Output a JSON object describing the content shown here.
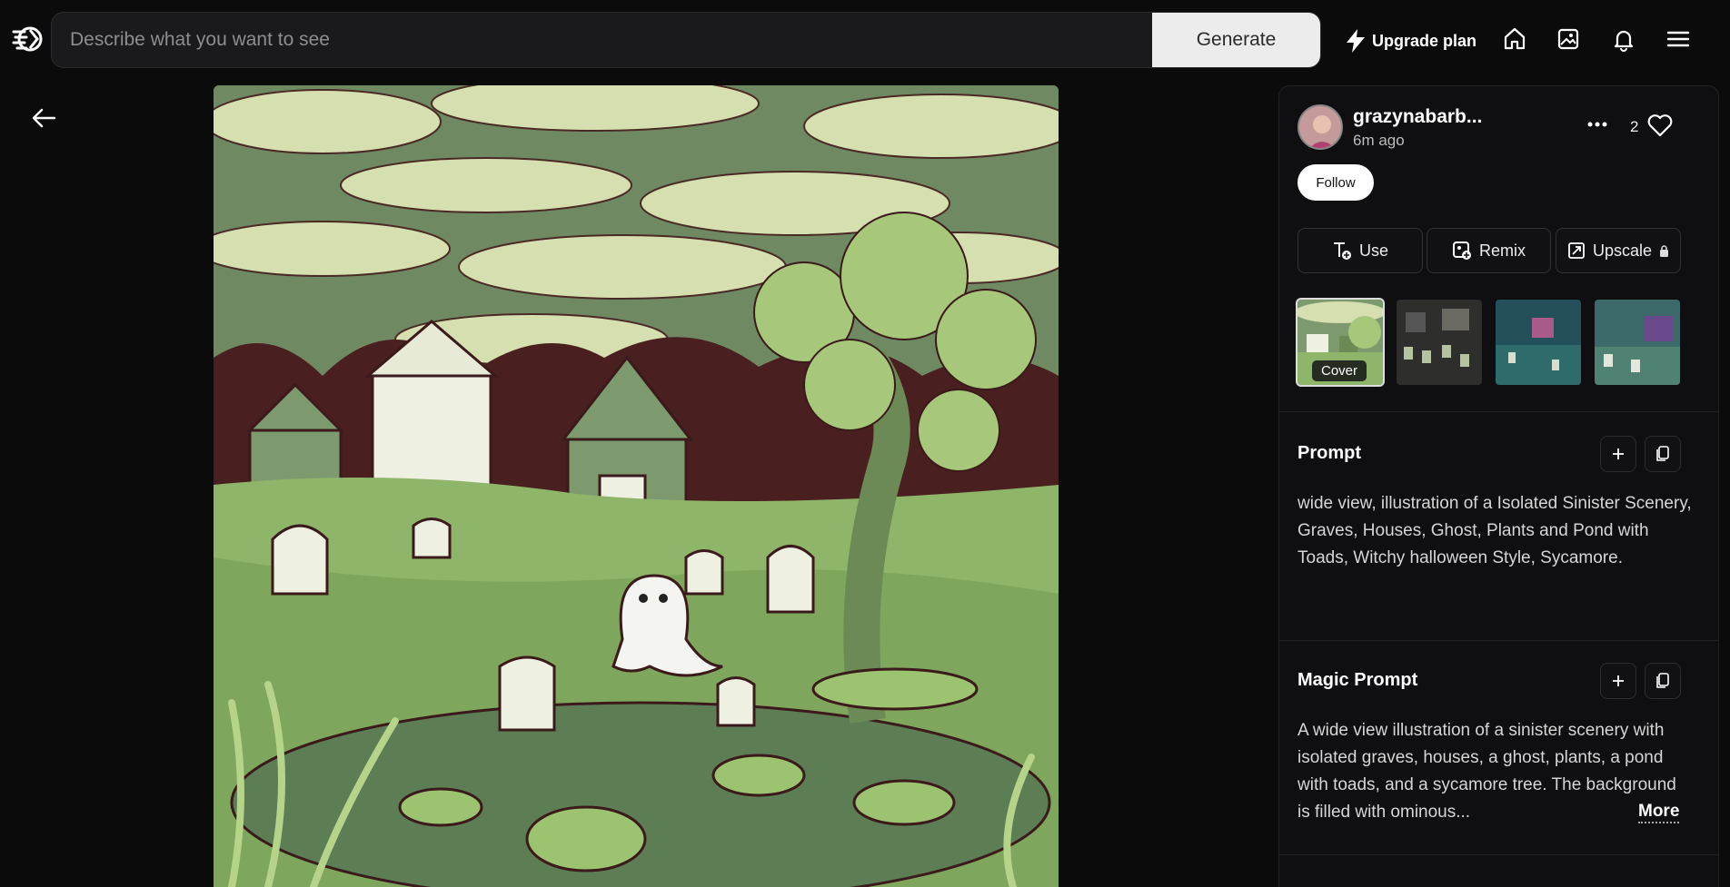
{
  "search": {
    "placeholder": "Describe what you want to see",
    "generate_label": "Generate"
  },
  "topnav": {
    "upgrade_label": "Upgrade plan",
    "icons": [
      "logo-icon",
      "bolt-icon",
      "home-icon",
      "gallery-icon",
      "bell-icon",
      "menu-icon"
    ]
  },
  "post": {
    "username": "grazynabarb...",
    "time_ago": "6m ago",
    "like_count": "2",
    "follow_label": "Follow"
  },
  "actions": [
    {
      "label": "Use",
      "icon": "text-plus-icon"
    },
    {
      "label": "Remix",
      "icon": "remix-icon"
    },
    {
      "label": "Upscale",
      "icon": "upscale-icon"
    }
  ],
  "thumbnails": {
    "cover_label": "Cover"
  },
  "prompt": {
    "title": "Prompt",
    "text": "wide view, illustration of a Isolated Sinister Scenery, Graves, Houses, Ghost, Plants and Pond with Toads, Witchy halloween Style, Sycamore."
  },
  "magic_prompt": {
    "title": "Magic Prompt",
    "text": "A wide view illustration of a sinister scenery with isolated graves, houses, a ghost, plants, a pond with toads, and a sycamore tree. The background is filled with ominous...",
    "more_label": "More"
  },
  "colors": {
    "background": "#0b0b0c",
    "panel": "#0f0f11",
    "illustration_green": "#8fb56a",
    "illustration_dark": "#4a1f1f",
    "cloud": "#d8e3b4"
  }
}
